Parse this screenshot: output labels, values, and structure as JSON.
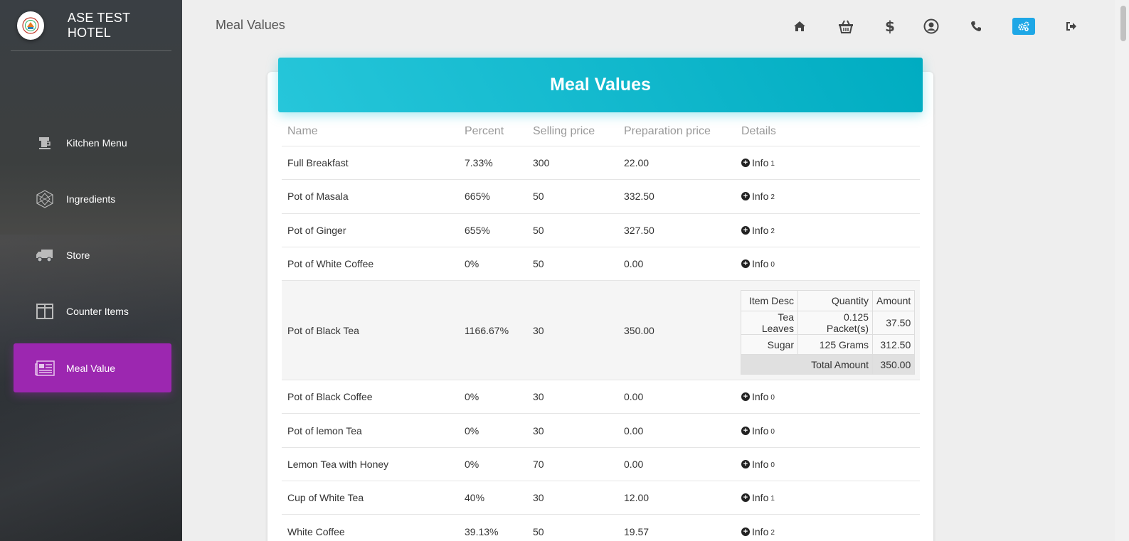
{
  "app": {
    "title": "ASE TEST HOTEL"
  },
  "sidebar": {
    "items": [
      {
        "label": "Kitchen Menu",
        "icon": "coffee-maker-icon",
        "active": false
      },
      {
        "label": "Ingredients",
        "icon": "polyhedron-icon",
        "active": false
      },
      {
        "label": "Store",
        "icon": "truck-icon",
        "active": false
      },
      {
        "label": "Counter Items",
        "icon": "columns-icon",
        "active": false
      },
      {
        "label": "Meal Value",
        "icon": "newspaper-icon",
        "active": true
      }
    ]
  },
  "topbar": {
    "page_name": "Meal Values",
    "icons": [
      "home-icon",
      "basket-icon",
      "dollar-icon",
      "user-circle-icon",
      "phone-icon",
      "settings-icon",
      "logout-icon"
    ],
    "accent": "#1ea7e6"
  },
  "card": {
    "title": "Meal Values",
    "header_color": "#00bcd4",
    "columns": [
      "Name",
      "Percent",
      "Selling price",
      "Preparation price",
      "Details"
    ],
    "info_label": "Info",
    "rows": [
      {
        "name": "Full Breakfast",
        "percent": "7.33%",
        "selling": "300",
        "prep": "22.00",
        "count": "1"
      },
      {
        "name": "Pot of Masala",
        "percent": "665%",
        "selling": "50",
        "prep": "332.50",
        "count": "2"
      },
      {
        "name": "Pot of Ginger",
        "percent": "655%",
        "selling": "50",
        "prep": "327.50",
        "count": "2"
      },
      {
        "name": "Pot of White Coffee",
        "percent": "0%",
        "selling": "50",
        "prep": "0.00",
        "count": "0"
      },
      {
        "name": "Pot of Black Tea",
        "percent": "1166.67%",
        "selling": "30",
        "prep": "350.00",
        "count": ""
      },
      {
        "name": "Pot of Black Coffee",
        "percent": "0%",
        "selling": "30",
        "prep": "0.00",
        "count": "0"
      },
      {
        "name": "Pot of lemon Tea",
        "percent": "0%",
        "selling": "30",
        "prep": "0.00",
        "count": "0"
      },
      {
        "name": "Lemon Tea with Honey",
        "percent": "0%",
        "selling": "70",
        "prep": "0.00",
        "count": "0"
      },
      {
        "name": "Cup of White Tea",
        "percent": "40%",
        "selling": "30",
        "prep": "12.00",
        "count": "1"
      },
      {
        "name": "White Coffee",
        "percent": "39.13%",
        "selling": "50",
        "prep": "19.57",
        "count": "2"
      }
    ],
    "details": {
      "headers": [
        "Item Desc",
        "Quantity",
        "Amount"
      ],
      "items": [
        {
          "desc": "Tea Leaves",
          "qty": "0.125 Packet(s)",
          "amount": "37.50"
        },
        {
          "desc": "Sugar",
          "qty": "125 Grams",
          "amount": "312.50"
        }
      ],
      "total_label": "Total Amount",
      "total": "350.00"
    }
  },
  "sidebar_active_color": "#9c27b0"
}
